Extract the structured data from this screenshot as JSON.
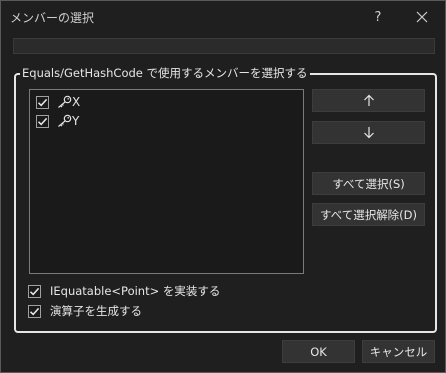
{
  "window": {
    "title": "メンバーの選択",
    "help_label": "?"
  },
  "group": {
    "label": "Equals/GetHashCode で使用するメンバーを選択する"
  },
  "members": [
    {
      "name": "X",
      "checked": true,
      "icon": "key-icon"
    },
    {
      "name": "Y",
      "checked": true,
      "icon": "key-icon"
    }
  ],
  "side_buttons": {
    "move_up_icon": "arrow-up-icon",
    "move_down_icon": "arrow-down-icon",
    "select_all": "すべて選択(S)",
    "deselect_all": "すべて選択解除(D)"
  },
  "options": [
    {
      "label": "IEquatable<Point> を実装する",
      "checked": true
    },
    {
      "label": "演算子を生成する",
      "checked": true
    }
  ],
  "footer": {
    "ok": "OK",
    "cancel": "キャンセル"
  }
}
